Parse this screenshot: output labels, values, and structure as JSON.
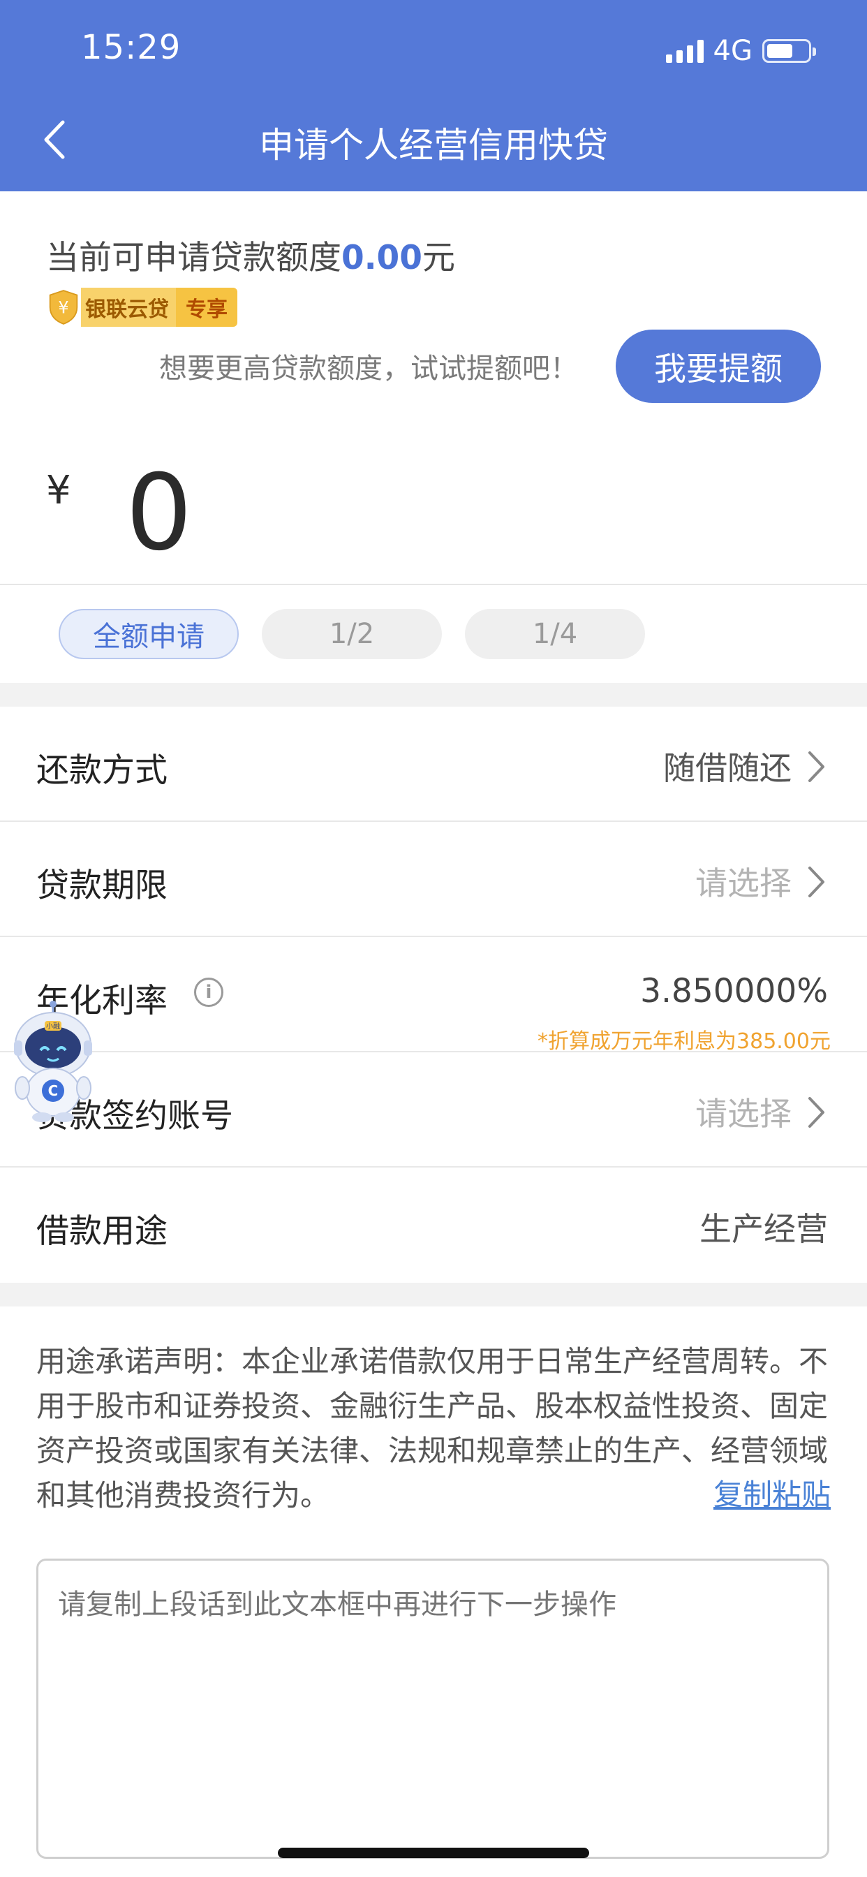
{
  "status_bar": {
    "time": "15:29",
    "network": "4G"
  },
  "header": {
    "title": "申请个人经营信用快贷"
  },
  "quota": {
    "prefix": "当前可申请贷款额度",
    "amount": "0.00",
    "unit": "元",
    "badge_left": "银联云贷",
    "badge_right": "专享",
    "raise_tip": "想要更高贷款额度，试试提额吧！",
    "raise_button": "我要提额"
  },
  "loan_amount": {
    "currency": "¥",
    "value": "0"
  },
  "amount_options": [
    {
      "label": "全额申请",
      "active": true
    },
    {
      "label": "1/2",
      "active": false
    },
    {
      "label": "1/4",
      "active": false
    }
  ],
  "rows": {
    "repayment": {
      "label": "还款方式",
      "value": "随借随还"
    },
    "term": {
      "label": "贷款期限",
      "value": "请选择"
    },
    "rate": {
      "label": "年化利率",
      "value": "3.850000%",
      "note": "*折算成万元年利息为385.00元"
    },
    "account": {
      "label": "贷款签约账号",
      "value": "请选择"
    },
    "purpose": {
      "label": "借款用途",
      "value": "生产经营"
    }
  },
  "statement": {
    "text": "用途承诺声明：本企业承诺借款仅用于日常生产经营周转。不用于股市和证券投资、金融衍生产品、股本权益性投资、固定资产投资或国家有关法律、法规和规章禁止的生产、经营领域和其他消费投资行为。",
    "copy_link": "复制粘贴",
    "input_placeholder": "请复制上段话到此文本框中再进行下一步操作"
  },
  "mascot_text": "小融",
  "colors": {
    "primary": "#5579d8",
    "accent_orange": "#f0a330",
    "link": "#4a82d6"
  }
}
